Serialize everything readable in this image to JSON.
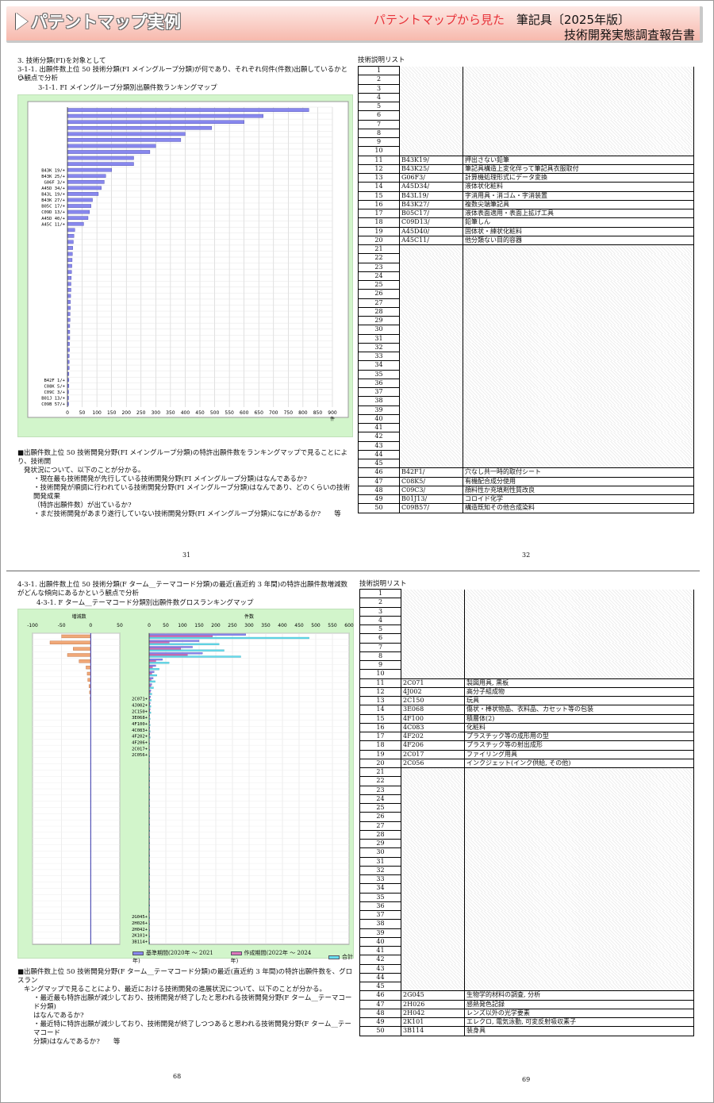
{
  "header": {
    "title": "パテントマップ実例",
    "right_red": "パテントマップから見た",
    "right_black": "筆記具〔2025年版〕",
    "sub": "技術開発実態調査報告書"
  },
  "top": {
    "s1": "3. 技術分類(FI)を対象として",
    "s2": "3-1-1. 出願件数上位 50 技術分類(FI メイングループ分類)が何であり、それぞれ何件(件数)出願しているかとい",
    "s2b": "う観点で分析",
    "s3": "3-1-1. FI メイングループ分類別出願件数ランキングマップ",
    "para": [
      "■出願件数上位 50 技術開発分野(FI メイングループ分類)の特許出願件数をランキングマップで見ることにより、技術開",
      "発状況について、以下のことが分かる。",
      "・現在最も技術開発が先行している技術開発分野(FI メイングループ分類)はなんであるか?",
      "・技術開発が順調に行われている技術開発分野(FI メイングループ分類)はなんであり、どのくらいの技術開発成果",
      "（特許出願件数）が出ているか?",
      "・まだ技術開発があまり遂行していない技術開発分野(FI メイングループ分類)になにがあるか?　　等"
    ],
    "list_title": "技術説明リスト",
    "page_left": "31",
    "page_right": "32"
  },
  "bottom": {
    "s1": "4-3-1. 出願件数上位 50 技術分類(F ターム__テーマコード分類)の最近(直近約 3 年間)の特許出願件数増減数",
    "s1b": "がどんな傾向にあるかという観点で分析",
    "s2": "4-3-1. F ターム__テーマコード分類別出願件数グロスランキングマップ",
    "para": [
      "■出願件数上位 50 技術開発分野(F ターム__テーマコード分類)の最近(直近約 3 年間)の特許出願件数を、グロスラン",
      "キングマップで見ることにより、最近における技術開発の進展状況について、以下のことが分かる。",
      "・最近最も特許出願が減少しており、技術開発が終了したと思われる技術開発分野(F ターム__テーマコード分類)",
      "はなんであるか?",
      "・最近特に特許出願が減少しており、技術開発が終了しつつあると思われる技術開発分野(F ターム__テーマコード",
      "分類)はなんであるか?　　等"
    ],
    "list_title": "技術説明リスト",
    "page_left": "68",
    "page_right": "69",
    "legend": [
      "基準期間(2020年 ～ 2021年)",
      "作成期間(2022年 ～ 2024年)",
      "合計"
    ]
  },
  "chart_data": [
    {
      "type": "bar",
      "orientation": "horizontal",
      "xlim": [
        0,
        900
      ],
      "xticks": [
        0,
        50,
        100,
        150,
        200,
        250,
        300,
        350,
        400,
        450,
        500,
        550,
        600,
        650,
        700,
        750,
        800,
        850,
        900
      ],
      "xlabel": "件",
      "visible_labels": {
        "11": "B43K 19/+",
        "12": "B43K 25/+",
        "13": "G06F 3/+",
        "14": "A45D 34/+",
        "15": "B43L 19/+",
        "16": "B43K 27/+",
        "17": "B05C 17/+",
        "18": "C09D 13/+",
        "19": "A45D 40/+",
        "20": "A45C 11/+",
        "46": "B42F 1/+",
        "47": "C08K 5/+",
        "48": "C09C 3/+",
        "49": "B01J 13/+",
        "50": "C09B 57/+"
      },
      "values": [
        820,
        665,
        600,
        490,
        400,
        385,
        300,
        280,
        225,
        225,
        150,
        130,
        125,
        115,
        105,
        85,
        80,
        75,
        70,
        55,
        25,
        22,
        20,
        18,
        17,
        16,
        15,
        14,
        13,
        12,
        12,
        11,
        10,
        10,
        9,
        9,
        8,
        8,
        8,
        7,
        7,
        6,
        6,
        6,
        5,
        5,
        5,
        4,
        4,
        4
      ]
    },
    {
      "type": "bar",
      "orientation": "horizontal",
      "panel": "増減数",
      "xlim": [
        -100,
        50
      ],
      "xticks": [
        -100,
        -50,
        0,
        50
      ],
      "values": [
        -50,
        -70,
        -30,
        -40,
        -20,
        -8,
        -6,
        -5,
        -3,
        -2,
        -1,
        0,
        0,
        0,
        0,
        0,
        0,
        0,
        0,
        0,
        0,
        0,
        0,
        0,
        0,
        0,
        0,
        0,
        0,
        0,
        0,
        0,
        0,
        0,
        0,
        0,
        0,
        0,
        0,
        0,
        0,
        0,
        0,
        0,
        0,
        0,
        0,
        0,
        0,
        0
      ]
    },
    {
      "type": "bar",
      "orientation": "horizontal",
      "panel": "件数",
      "xlim": [
        0,
        600
      ],
      "xticks": [
        0,
        50,
        100,
        150,
        200,
        250,
        300,
        350,
        400,
        450,
        500,
        550,
        600
      ],
      "visible_labels": {
        "11": "2C071+",
        "12": "4J002+",
        "13": "2C150+",
        "14": "3E068+",
        "15": "4F100+",
        "16": "4C083+",
        "17": "4F202+",
        "18": "4F206+",
        "19": "2C017+",
        "20": "2C056+",
        "46": "2G045+",
        "47": "2H026+",
        "48": "2H042+",
        "49": "2K101+",
        "50": "3B114+"
      },
      "series": [
        {
          "name": "基準期間(2020年 ～ 2021年)",
          "values": [
            290,
            150,
            130,
            160,
            40,
            20,
            15,
            12,
            8,
            5,
            4,
            3,
            3,
            2,
            2,
            2,
            2,
            1,
            1,
            1,
            1,
            1,
            1,
            1,
            1,
            1,
            1,
            1,
            1,
            1,
            1,
            1,
            1,
            1,
            1,
            1,
            1,
            1,
            1,
            1,
            1,
            1,
            1,
            1,
            1,
            1,
            1,
            1,
            1,
            1
          ]
        },
        {
          "name": "作成期間(2022年 ～ 2024年)",
          "values": [
            190,
            60,
            95,
            115,
            20,
            10,
            8,
            6,
            5,
            3,
            2,
            2,
            2,
            1,
            1,
            1,
            1,
            1,
            1,
            1,
            1,
            1,
            1,
            1,
            1,
            1,
            1,
            1,
            1,
            1,
            1,
            1,
            1,
            1,
            1,
            1,
            1,
            1,
            1,
            1,
            1,
            1,
            1,
            1,
            1,
            1,
            1,
            1,
            1,
            1
          ]
        },
        {
          "name": "合計",
          "values": [
            480,
            210,
            225,
            275,
            60,
            30,
            23,
            18,
            13,
            8,
            6,
            5,
            5,
            3,
            3,
            3,
            3,
            2,
            2,
            2,
            2,
            2,
            2,
            2,
            2,
            2,
            2,
            2,
            2,
            2,
            2,
            2,
            2,
            2,
            2,
            2,
            2,
            2,
            2,
            2,
            2,
            2,
            2,
            2,
            2,
            2,
            2,
            2,
            2,
            2
          ]
        }
      ]
    }
  ],
  "list_top": {
    "11": [
      "B43K19/",
      "押出さない鉛筆"
    ],
    "12": [
      "B43K25/",
      "筆記具構造上変化伴って筆記具衣服取付"
    ],
    "13": [
      "G06F3/",
      "計算機処理形式にデータ変換"
    ],
    "14": [
      "A45D34/",
      "液体状化粧料"
    ],
    "15": [
      "B43L19/",
      "字消用具・消ゴム・字消装置"
    ],
    "16": [
      "B43K27/",
      "複数尖端筆記具"
    ],
    "17": [
      "B05C17/",
      "液体表面適用・表面上拡げ工具"
    ],
    "18": [
      "C09D13/",
      "鉛筆しん"
    ],
    "19": [
      "A45D40/",
      "固体状・練状化粧料"
    ],
    "20": [
      "A45C11/",
      "他分類ない目的容器"
    ],
    "46": [
      "B42F1/",
      "穴なし共一時的取付シート"
    ],
    "47": [
      "C08K5/",
      "有機配合成分使用"
    ],
    "48": [
      "C09C3/",
      "顔料性か充填剤性質改良"
    ],
    "49": [
      "B01J13/",
      "コロイド化学"
    ],
    "50": [
      "C09B57/",
      "構造既知その他合成染料"
    ]
  },
  "list_bottom": {
    "11": [
      "2C071",
      "製図用具, 黒板"
    ],
    "12": [
      "4J002",
      "高分子組成物"
    ],
    "13": [
      "2C150",
      "玩具"
    ],
    "14": [
      "3E068",
      "傷状・棒状物品、衣料品、カセット等の包装"
    ],
    "15": [
      "4F100",
      "積層体(2)"
    ],
    "16": [
      "4C083",
      "化粧料"
    ],
    "17": [
      "4F202",
      "プラスチック等の成形用の型"
    ],
    "18": [
      "4F206",
      "プラスチック等の射出成形"
    ],
    "19": [
      "2C017",
      "ファイリング用具"
    ],
    "20": [
      "2C056",
      "インクジェット(インク供給, その他)"
    ],
    "46": [
      "2G045",
      "生物学的材料の調査, 分析"
    ],
    "47": [
      "2H026",
      "感熱発色記録"
    ],
    "48": [
      "2H042",
      "レンズ以外の光学要素"
    ],
    "49": [
      "2K101",
      "エレクロ, 電気泳動, 可変反射吸収素子"
    ],
    "50": [
      "3B114",
      "装身具"
    ]
  }
}
